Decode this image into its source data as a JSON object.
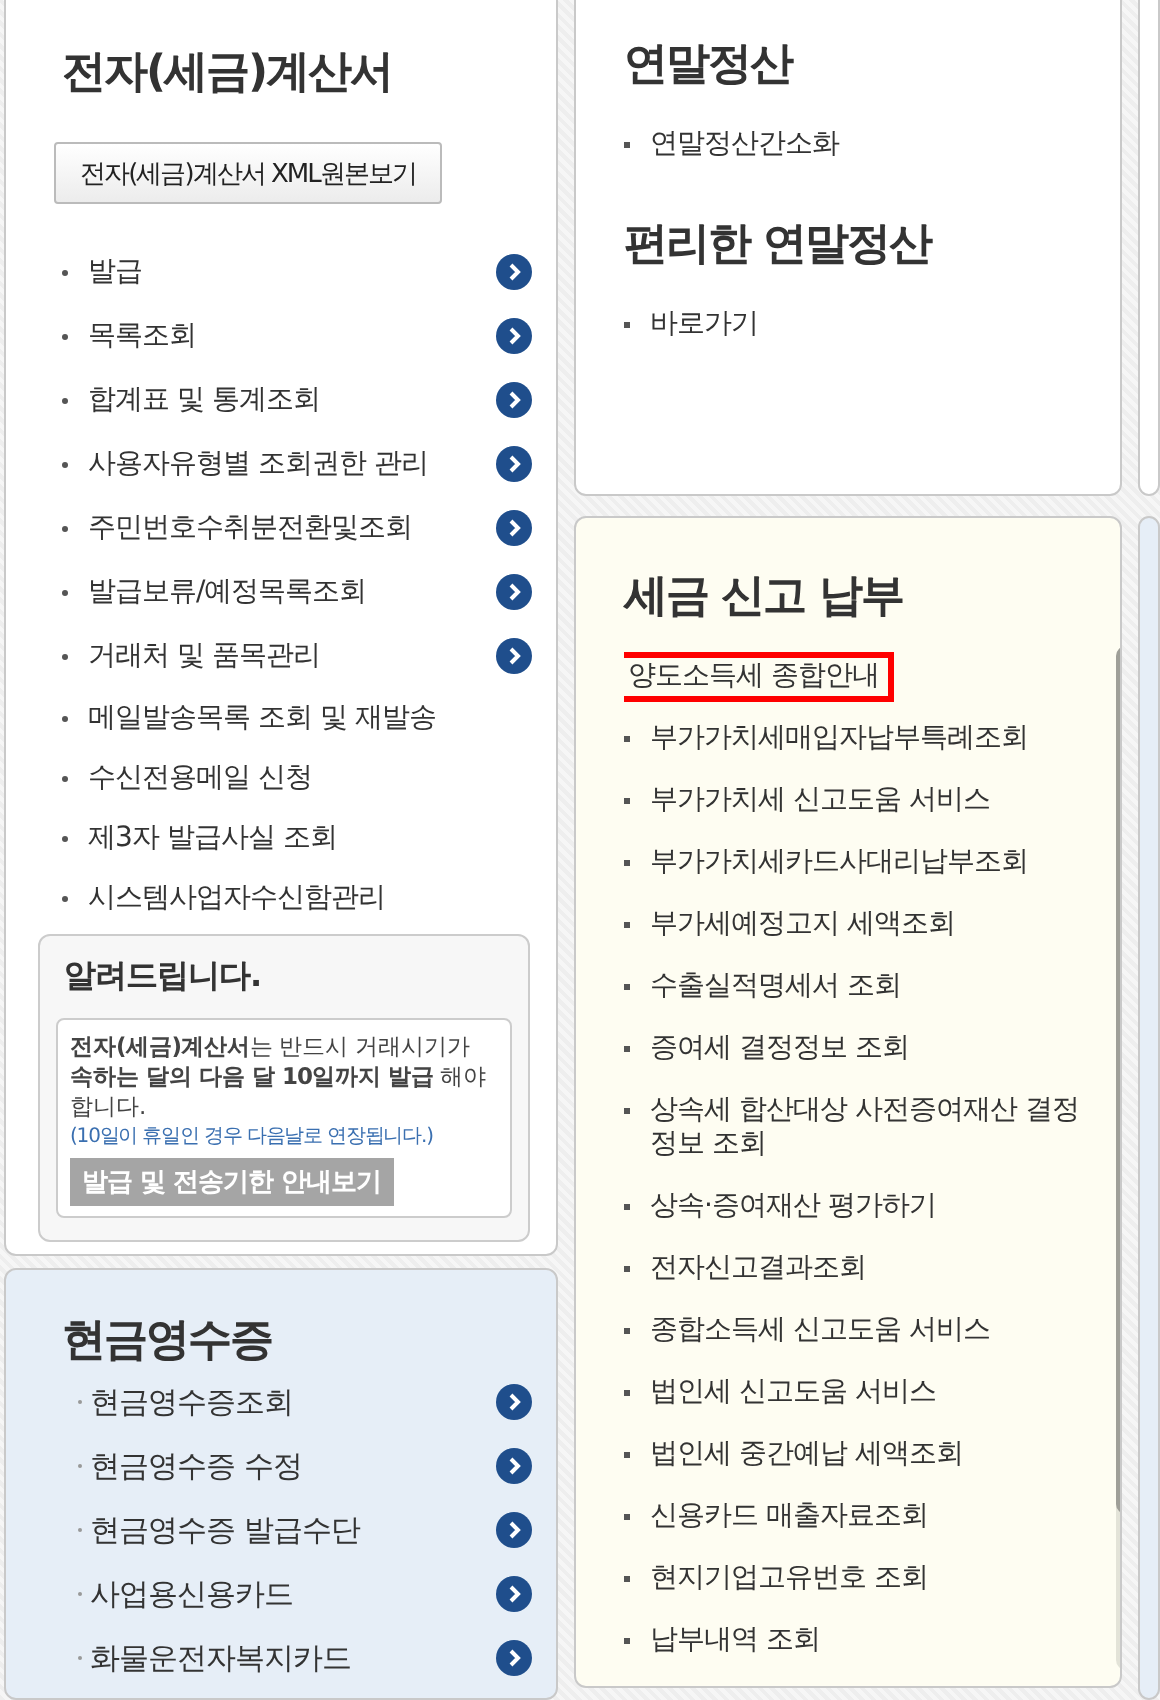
{
  "invoice": {
    "title": "전자(세금)계산서",
    "xml_button": "전자(세금)계산서 XML원본보기",
    "items": [
      {
        "label": "발급",
        "arrow": true
      },
      {
        "label": "목록조회",
        "arrow": true
      },
      {
        "label": "합계표 및 통계조회",
        "arrow": true
      },
      {
        "label": "사용자유형별 조회권한 관리",
        "arrow": true
      },
      {
        "label": "주민번호수취분전환및조회",
        "arrow": true
      },
      {
        "label": "발급보류/예정목록조회",
        "arrow": true
      },
      {
        "label": "거래처 및 품목관리",
        "arrow": true
      },
      {
        "label": "메일발송목록 조회 및 재발송",
        "arrow": false
      },
      {
        "label": "수신전용메일 신청",
        "arrow": false
      },
      {
        "label": "제3자 발급사실 조회",
        "arrow": false
      },
      {
        "label": "시스템사업자수신함관리",
        "arrow": false
      }
    ]
  },
  "notice": {
    "title": "알려드립니다.",
    "message": "**전자(세금)계산서**는 반드시 거래시기가 **속하는 달의 다음 달 10일까지 발급** 해야 합니다.",
    "note": "(10일이 휴일인 경우 다음날로 연장됩니다.)",
    "button": "발급 및 전송기한 안내보기"
  },
  "cash_receipt": {
    "title": "현금영수증",
    "items": [
      {
        "label": "현금영수증조회",
        "arrow": true
      },
      {
        "label": "현금영수증 수정",
        "arrow": true
      },
      {
        "label": "현금영수증 발급수단",
        "arrow": true
      },
      {
        "label": "사업용신용카드",
        "arrow": true
      },
      {
        "label": "화물운전자복지카드",
        "arrow": true
      }
    ]
  },
  "year_end": {
    "title": "연말정산",
    "items": [
      "연말정산간소화"
    ],
    "title_2": "편리한 연말정산",
    "items_2": [
      "바로가기"
    ]
  },
  "tax_filing": {
    "title": "세금 신고 납부",
    "items": [
      {
        "label": "양도소득세 종합안내",
        "highlighted": true
      },
      {
        "label": "부가가치세매입자납부특례조회",
        "highlighted": false
      },
      {
        "label": "부가가치세 신고도움 서비스",
        "highlighted": false
      },
      {
        "label": "부가가치세카드사대리납부조회",
        "highlighted": false
      },
      {
        "label": "부가세예정고지 세액조회",
        "highlighted": false
      },
      {
        "label": "수출실적명세서 조회",
        "highlighted": false
      },
      {
        "label": "증여세 결정정보 조회",
        "highlighted": false
      },
      {
        "label": "상속세 합산대상 사전증여재산 결정정보 조회",
        "highlighted": false
      },
      {
        "label": "상속·증여재산 평가하기",
        "highlighted": false
      },
      {
        "label": "전자신고결과조회",
        "highlighted": false
      },
      {
        "label": "종합소득세 신고도움 서비스",
        "highlighted": false
      },
      {
        "label": "법인세 신고도움 서비스",
        "highlighted": false
      },
      {
        "label": "법인세 중간예납 세액조회",
        "highlighted": false
      },
      {
        "label": "신용카드 매출자료조회",
        "highlighted": false
      },
      {
        "label": "현지기업고유번호 조회",
        "highlighted": false
      },
      {
        "label": "납부내역 조회",
        "highlighted": false
      }
    ]
  }
}
